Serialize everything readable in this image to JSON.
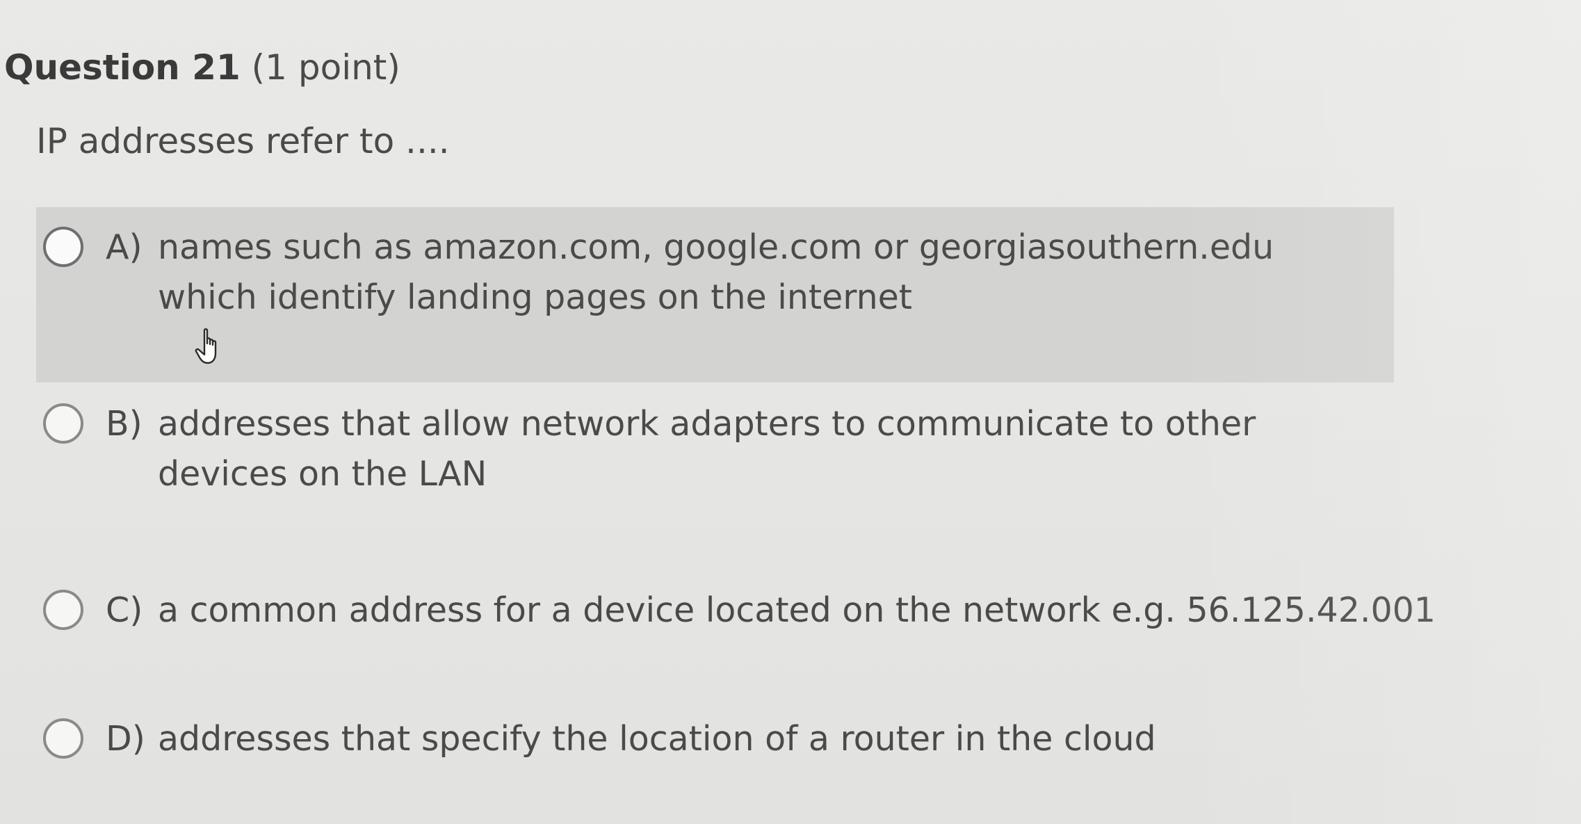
{
  "question": {
    "title": "Question 21",
    "points": "(1 point)",
    "prompt": "IP addresses refer to ...."
  },
  "options": [
    {
      "letter": "A)",
      "text": "names such as amazon.com, google.com or georgiasouthern.edu which identify landing pages on the internet",
      "highlighted": true
    },
    {
      "letter": "B)",
      "text": "addresses that allow network adapters to communicate to other devices on the LAN",
      "highlighted": false
    },
    {
      "letter": "C)",
      "text": "a common address for a device located on the network e.g. 56.125.42.001",
      "highlighted": false
    },
    {
      "letter": "D)",
      "text": "addresses that specify the location of a router in the cloud",
      "highlighted": false
    }
  ],
  "cursor": {
    "icon": "hand-pointer-icon"
  },
  "colors": {
    "background": "#e6e6e4",
    "highlight": "#d3d3d1",
    "text": "#4a4a4a",
    "radio_border": "#8a8a8a"
  }
}
